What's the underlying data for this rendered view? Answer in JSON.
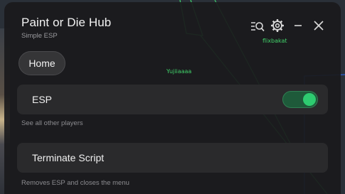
{
  "window": {
    "title": "Paint or Die Hub",
    "subtitle": "Simple ESP"
  },
  "header_icons": {
    "search": "search-icon",
    "settings": "gear-icon",
    "minimize": "minimize-icon",
    "close": "close-icon"
  },
  "tabs": [
    {
      "label": "Home",
      "active": true
    }
  ],
  "esp_row": {
    "label": "ESP",
    "description": "See all other players",
    "toggle_on": true
  },
  "terminate_row": {
    "label": "Terminate Script",
    "description": "Removes ESP and closes the menu"
  },
  "player_tags": {
    "a": "flixbakat",
    "b": "Yujiiaaaa"
  },
  "colors": {
    "accent": "#2ecb70",
    "esp_green": "#41d36a",
    "esp_blue": "#2a5fd6",
    "panel_bg": "#1a1a1c"
  }
}
